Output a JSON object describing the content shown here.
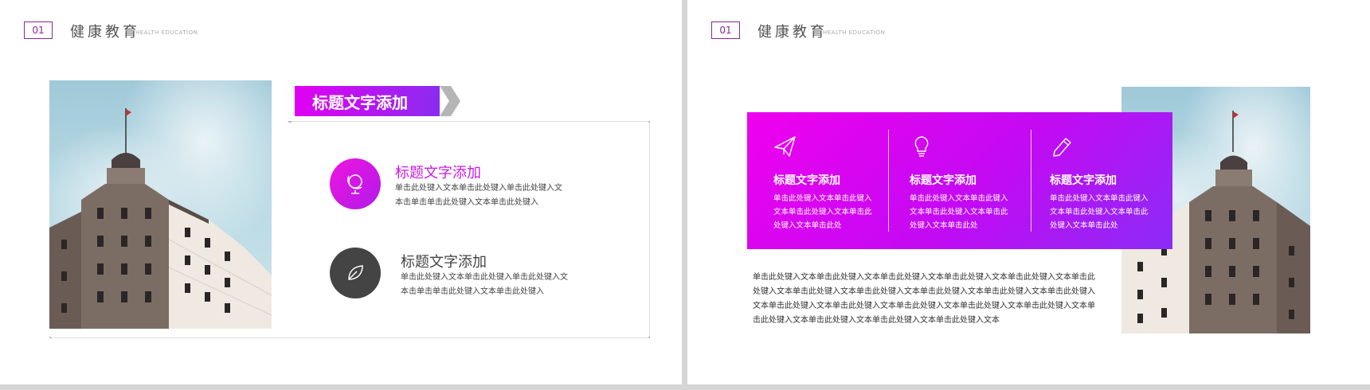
{
  "slides": [
    {
      "header": {
        "number": "01",
        "title": "健康教育",
        "subtitle": "HEALTH EDUCATION"
      },
      "banner_title": "标题文字添加",
      "items": [
        {
          "title": "标题文字添加",
          "body": "单击此处键入文本单击此处键入单击此处键入文本击单击单击此处键入文本单击此处键入",
          "icon": "globe-icon",
          "color": "#d21ce6"
        },
        {
          "title": "标题文字添加",
          "body": "单击此处键入文本单击此处键入单击此处键入文本击单击单击此处键入文本单击此处键入",
          "icon": "leaf-icon",
          "color": "#444444"
        }
      ]
    },
    {
      "header": {
        "number": "01",
        "title": "健康教育",
        "subtitle": "HEALTH EDUCATION"
      },
      "columns": [
        {
          "title": "标题文字添加",
          "body": "单击此处键入文本单击此键入文本单击此处键入文本单击此处键入文本单击此处",
          "icon": "paper-plane-icon"
        },
        {
          "title": "标题文字添加",
          "body": "单击此处键入文本单击此键入文本单击此处键入文本单击此处键入文本单击此处",
          "icon": "lightbulb-icon"
        },
        {
          "title": "标题文字添加",
          "body": "单击此处键入文本单击此键入文本单击此处键入文本单击此处键入文本单击此处",
          "icon": "pencil-icon"
        }
      ],
      "paragraph": "单击此处键入文本单击此处键入文本单击此处键入文本单击此处键入文本单击此处键入文本单击此处键入文本单击此处键入文本单击此处键入文本单击此处键入文本单击此处键入文本单击此处键入文本单击此处键入文本单击此处键入文本单击此处键入文本单击此处键入文本单击此处键入文本单击此处键入文本单击此处键入文本单击此处键入文本单击此处键入文本"
    }
  ],
  "colors": {
    "accent": "#e100f2",
    "accent_dark": "#8b2cf0",
    "badge": "#8a2a8f"
  }
}
